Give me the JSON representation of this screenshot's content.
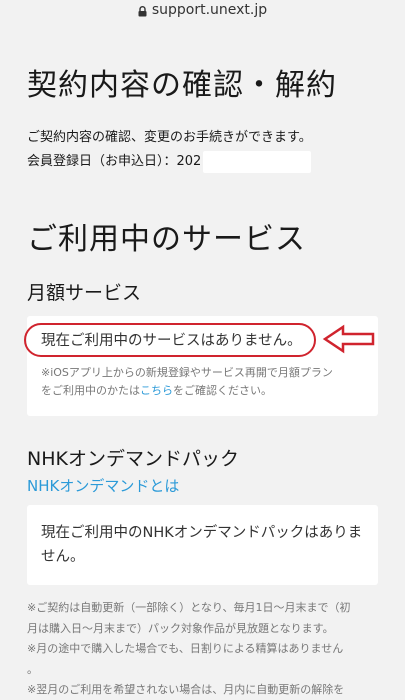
{
  "browser": {
    "url": "support.unext.jp"
  },
  "page": {
    "title": "契約内容の確認・解約",
    "intro_line1": "ご契約内容の確認、変更のお手続きができます。",
    "registration_label": "会員登録日（お申込日）：202"
  },
  "services": {
    "title": "ご利用中のサービス",
    "monthly": {
      "title": "月額サービス",
      "message": "現在ご利用中のサービスはありません。",
      "note_line1": "※iOSアプリ上からの新規登録やサービス再開で月額プラン",
      "note_line2_before": "をご利用中のかたは",
      "note_link": "こちら",
      "note_line2_after": "をご確認ください。"
    },
    "nhk": {
      "title": "NHKオンデマンドパック",
      "link": "NHKオンデマンドとは",
      "message": "現在ご利用中のNHKオンデマンドパックはありません。"
    }
  },
  "footnotes": {
    "line1": "※ご契約は自動更新（一部除く）となり、毎月1日〜月末まで（初",
    "line2": "月は購入日〜月末まで）パック対象作品が見放題となります。",
    "line3": "※月の途中で購入した場合でも、日割りによる精算はありません",
    "line4": "。",
    "line5": "※翌月のご利用を希望されない場合は、月内に自動更新の解除を"
  },
  "colors": {
    "background": "#f2f2f2",
    "card": "#ffffff",
    "link": "#2b9ad8",
    "annotation": "#d0242e"
  },
  "icons": {
    "lock": "lock-icon",
    "arrow": "left-arrow-annotation"
  }
}
